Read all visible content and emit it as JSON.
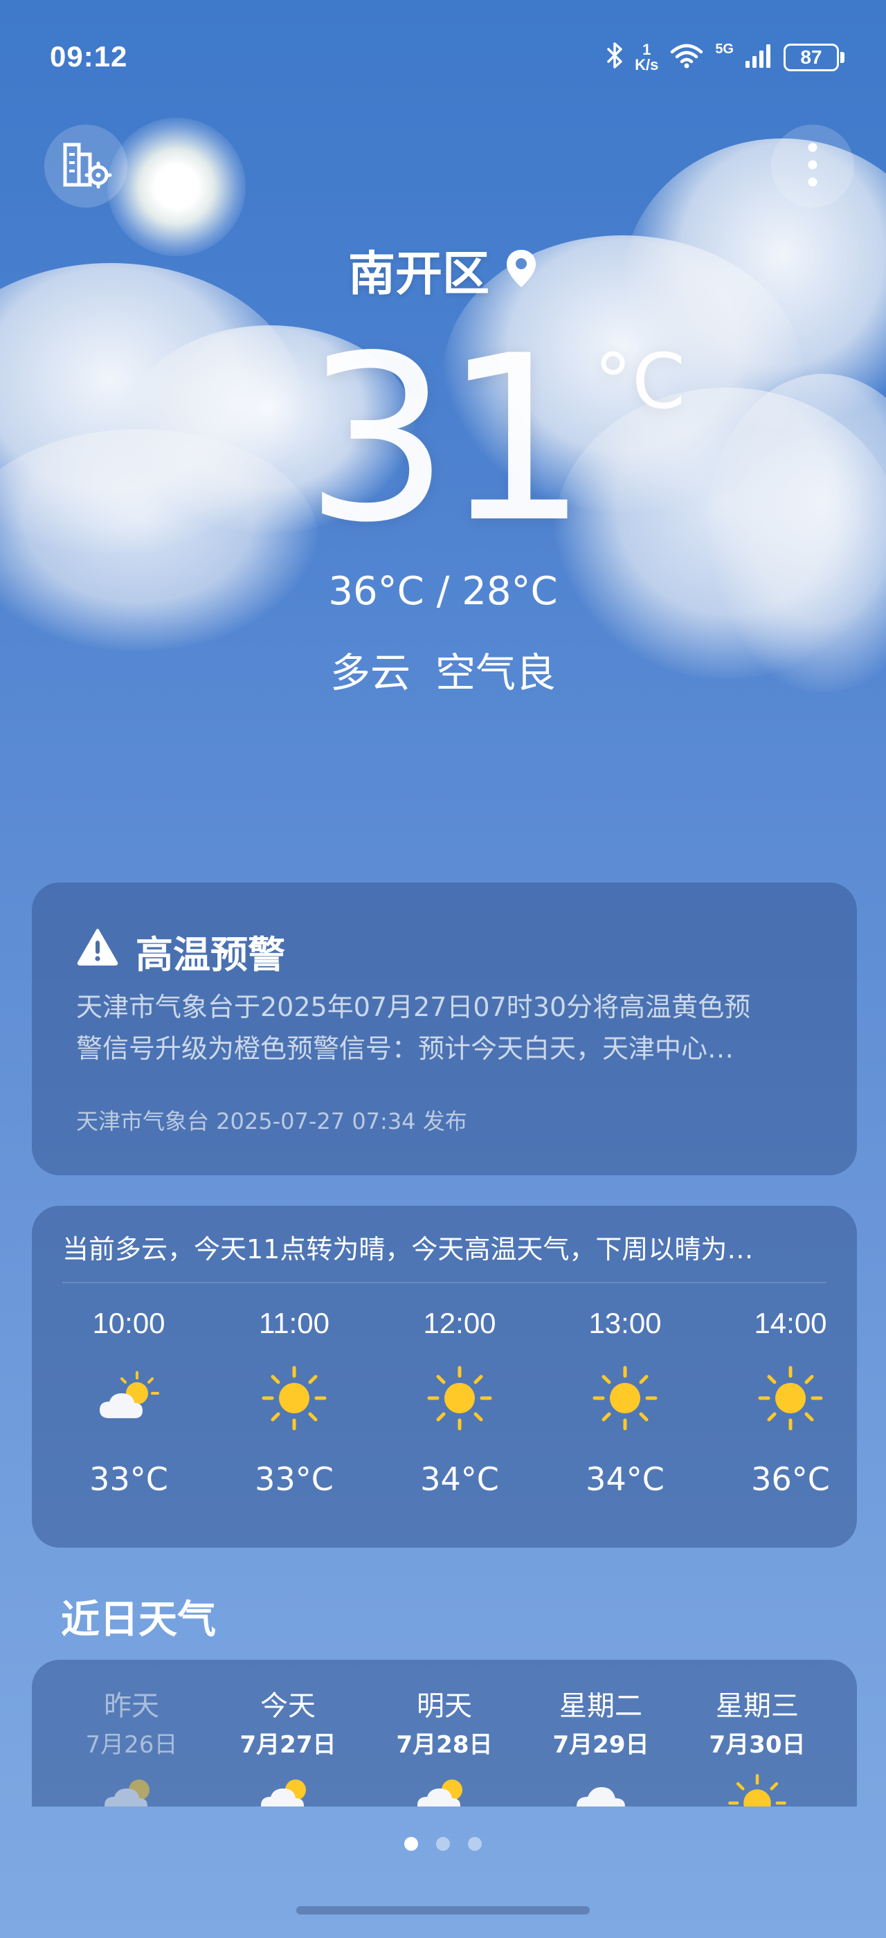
{
  "status_bar": {
    "time": "09:12",
    "net_speed_value": "1",
    "net_speed_unit": "K/s",
    "network_type": "5G",
    "battery": "87"
  },
  "header": {
    "location": "南开区"
  },
  "current": {
    "temperature": "31",
    "unit": "°C",
    "high_low": "36°C / 28°C",
    "condition": "多云",
    "air_quality": "空气良"
  },
  "alert": {
    "title": "高温预警",
    "body_line1": "天津市气象台于2025年07月27日07时30分将高温黄色预",
    "body_line2": "警信号升级为橙色预警信号：预计今天白天，天津中心…",
    "meta": "天津市气象台 2025-07-27 07:34 发布"
  },
  "hourly": {
    "summary": "当前多云，今天11点转为晴，今天高温天气，下周以晴为…",
    "items": [
      {
        "time": "10:00",
        "icon": "partly-cloudy-icon",
        "temp": "33°C"
      },
      {
        "time": "11:00",
        "icon": "sun-icon",
        "temp": "33°C"
      },
      {
        "time": "12:00",
        "icon": "sun-icon",
        "temp": "34°C"
      },
      {
        "time": "13:00",
        "icon": "sun-icon",
        "temp": "34°C"
      },
      {
        "time": "14:00",
        "icon": "sun-icon",
        "temp": "36°C"
      }
    ]
  },
  "daily": {
    "title": "近日天气",
    "items": [
      {
        "day": "昨天",
        "date": "7月26日",
        "icon": "partly-cloudy-icon"
      },
      {
        "day": "今天",
        "date": "7月27日",
        "icon": "partly-cloudy-icon"
      },
      {
        "day": "明天",
        "date": "7月28日",
        "icon": "partly-cloudy-icon"
      },
      {
        "day": "星期二",
        "date": "7月29日",
        "icon": "cloud-icon"
      },
      {
        "day": "星期三",
        "date": "7月30日",
        "icon": "sun-icon"
      }
    ]
  },
  "pager": {
    "count": 3,
    "active": 0
  },
  "colors": {
    "sun": "#ffc928",
    "sky_top": "#3f79c9",
    "sky_bottom": "#7fa9e2"
  }
}
